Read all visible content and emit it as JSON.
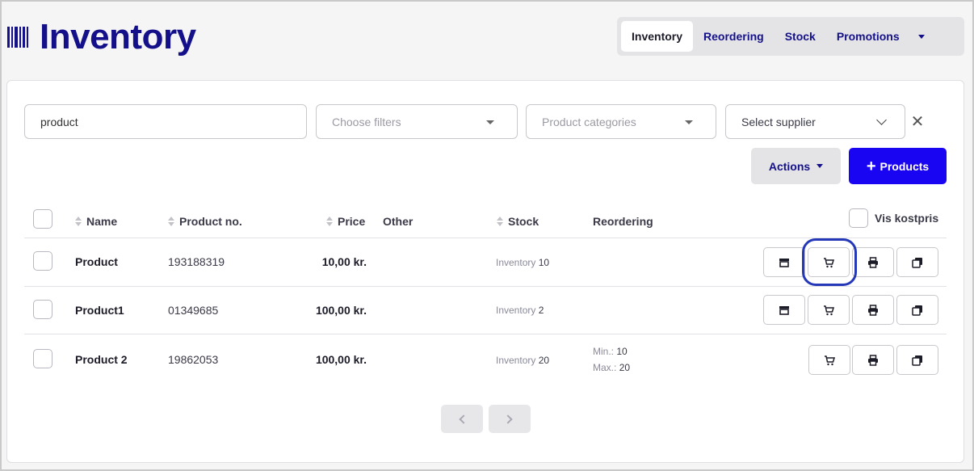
{
  "app": {
    "title": "Inventory",
    "icons": {
      "brand": "barcode-icon"
    }
  },
  "nav": {
    "tabs": [
      {
        "label": "Inventory",
        "active": true
      },
      {
        "label": "Reordering",
        "active": false
      },
      {
        "label": "Stock",
        "active": false
      },
      {
        "label": "Promotions",
        "active": false
      }
    ],
    "more_icon": "caret-down-icon"
  },
  "filters": {
    "search_value": "product",
    "filters_placeholder": "Choose filters",
    "categories_placeholder": "Product categories",
    "supplier_placeholder": "Select supplier",
    "clear_icon": "close-icon"
  },
  "toolbar": {
    "actions_label": "Actions",
    "add_products_label": "Products",
    "add_icon": "plus-icon"
  },
  "table": {
    "headers": {
      "name": "Name",
      "product_no": "Product no.",
      "price": "Price",
      "other": "Other",
      "stock": "Stock",
      "reordering": "Reordering"
    },
    "vis_kostpris_label": "Vis kostpris",
    "stock_label": "Inventory",
    "min_label": "Min.:",
    "max_label": "Max.:",
    "rows": [
      {
        "name": "Product",
        "product_no": "193188319",
        "price": "10,00 kr.",
        "stock": "10",
        "min": "",
        "max": "",
        "actions": [
          "store-icon",
          "cart-icon",
          "print-icon",
          "copy-icon"
        ],
        "highlighted_action": "cart-icon"
      },
      {
        "name": "Product1",
        "product_no": "01349685",
        "price": "100,00 kr.",
        "stock": "2",
        "min": "",
        "max": "",
        "actions": [
          "store-icon",
          "cart-icon",
          "print-icon",
          "copy-icon"
        ]
      },
      {
        "name": "Product 2",
        "product_no": "19862053",
        "price": "100,00 kr.",
        "stock": "20",
        "min": "10",
        "max": "20",
        "actions": [
          "cart-icon",
          "print-icon",
          "copy-icon"
        ]
      }
    ]
  },
  "pagination": {
    "prev_icon": "chevron-left-icon",
    "next_icon": "chevron-right-icon"
  },
  "colors": {
    "brand": "#14108a",
    "primary_button": "#1a05f2",
    "highlight_ring": "#2438b8"
  }
}
